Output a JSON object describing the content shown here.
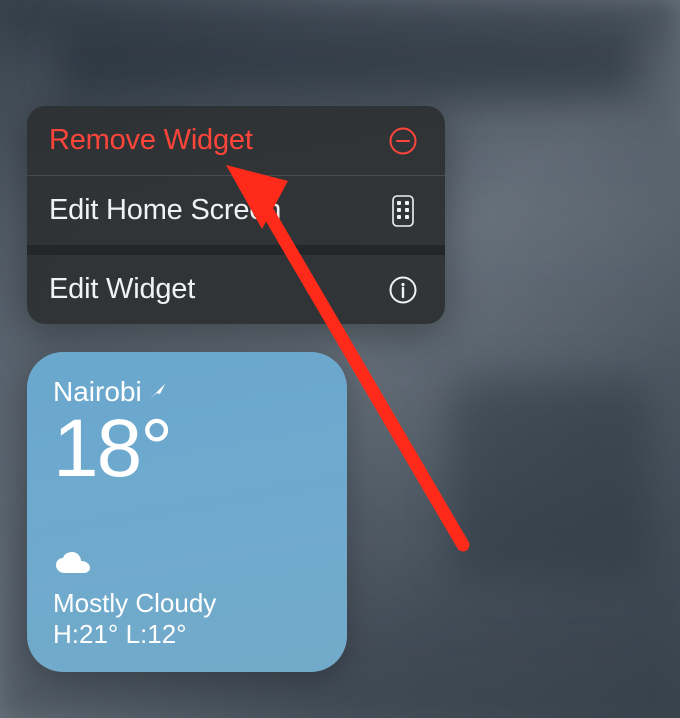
{
  "menu": {
    "remove_widget": "Remove Widget",
    "edit_home_screen": "Edit Home Screen",
    "edit_widget": "Edit Widget"
  },
  "weather": {
    "location": "Nairobi",
    "temp": "18°",
    "condition": "Mostly Cloudy",
    "high_label": "H:",
    "high_value": "21°",
    "low_label": "L:",
    "low_value": "12°"
  },
  "colors": {
    "destructive": "#ff453a",
    "widget_bg": "#6aa8cd",
    "arrow": "#ff2a1a"
  }
}
